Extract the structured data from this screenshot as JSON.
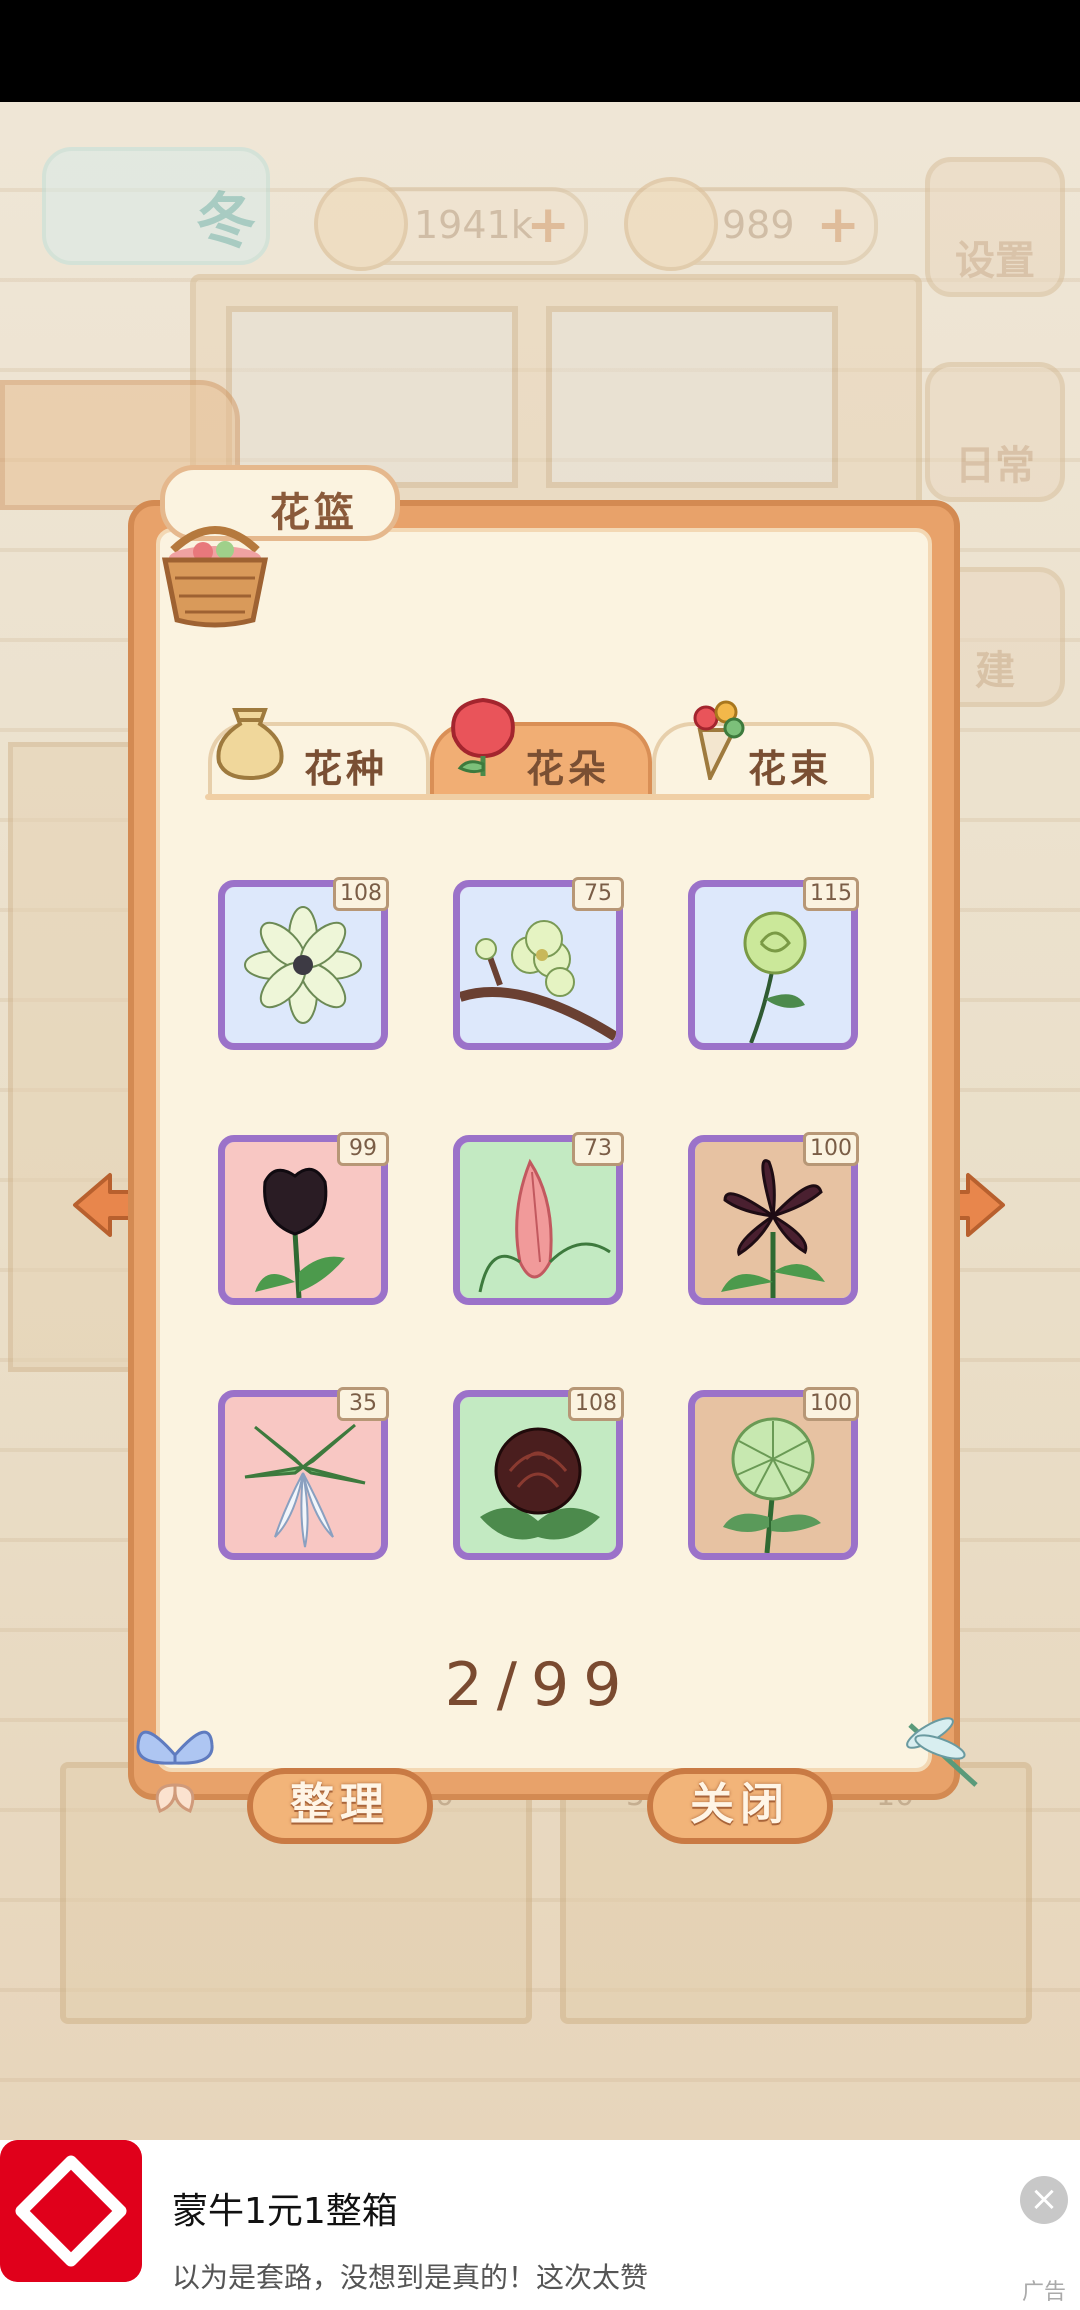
{
  "header": {
    "season_label": "冬",
    "fish_currency": "1941k",
    "cheese_currency": "989",
    "settings_label": "设置",
    "daily_label": "日常",
    "build_label": "建"
  },
  "panel": {
    "title": "花篮",
    "tabs": [
      {
        "label": "花种",
        "active": false
      },
      {
        "label": "花朵",
        "active": true
      },
      {
        "label": "花束",
        "active": false
      }
    ],
    "items": [
      {
        "name": "white-green-flower",
        "count": "108",
        "bg": "#dde8fb"
      },
      {
        "name": "green-plum-blossom",
        "count": "75",
        "bg": "#dde8fb"
      },
      {
        "name": "green-rose",
        "count": "115",
        "bg": "#dde8fb"
      },
      {
        "name": "black-tulip",
        "count": "99",
        "bg": "#f8c7c3"
      },
      {
        "name": "pink-plume-celosia",
        "count": "73",
        "bg": "#c3eac2"
      },
      {
        "name": "dark-lily",
        "count": "100",
        "bg": "#e7c2a2"
      },
      {
        "name": "white-lily",
        "count": "35",
        "bg": "#f8c7c3"
      },
      {
        "name": "dark-peony",
        "count": "108",
        "bg": "#c3eac2"
      },
      {
        "name": "green-chrysanthemum",
        "count": "100",
        "bg": "#e7c2a2"
      }
    ],
    "page_indicator": "2/99",
    "sort_button": "整理",
    "close_button": "关闭"
  },
  "background": {
    "counter_numbers": [
      "10",
      "50",
      "10"
    ]
  },
  "ad": {
    "title": "蒙牛1元1整箱",
    "subtitle": "以为是套路，没想到是真的！这次太赞",
    "tag": "广告",
    "close": "×"
  },
  "colors": {
    "panel_border": "#e8a26a",
    "panel_fill": "#fbf3e0",
    "slot_border": "#9b72c9",
    "active_tab": "#f1ae74",
    "ad_brand": "#e0001b"
  }
}
